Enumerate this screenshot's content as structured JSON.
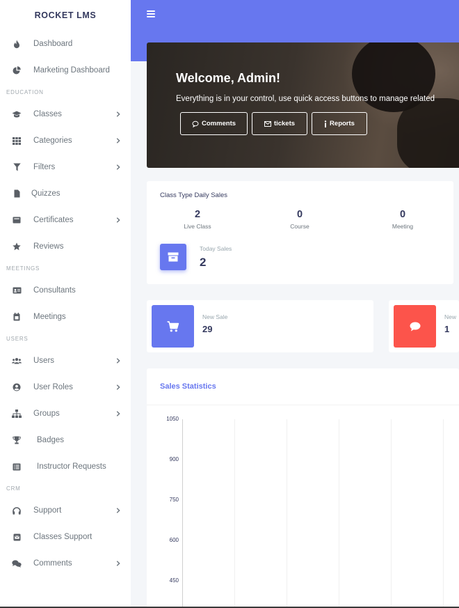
{
  "sidebar": {
    "brand": "ROCKET LMS",
    "items": [
      {
        "type": "item",
        "name": "sidebar-item-dashboard",
        "icon": "fire-icon",
        "label": "Dashboard",
        "chevron": false
      },
      {
        "type": "item",
        "name": "sidebar-item-marketing-dashboard",
        "icon": "chart-pie-icon",
        "label": "Marketing Dashboard",
        "chevron": false
      },
      {
        "type": "header",
        "label": "EDUCATION"
      },
      {
        "type": "item",
        "name": "sidebar-item-classes",
        "icon": "graduation-cap-icon",
        "label": "Classes",
        "chevron": true
      },
      {
        "type": "item",
        "name": "sidebar-item-categories",
        "icon": "th-icon",
        "label": "Categories",
        "chevron": true
      },
      {
        "type": "item",
        "name": "sidebar-item-filters",
        "icon": "filter-icon",
        "label": "Filters",
        "chevron": true
      },
      {
        "type": "item",
        "name": "sidebar-item-quizzes",
        "icon": "file-icon",
        "label": "Quizzes",
        "chevron": false,
        "variant": "narrow"
      },
      {
        "type": "item",
        "name": "sidebar-item-certificates",
        "icon": "certificate-icon",
        "label": "Certificates",
        "chevron": true
      },
      {
        "type": "item",
        "name": "sidebar-item-reviews",
        "icon": "star-icon",
        "label": "Reviews",
        "chevron": false
      },
      {
        "type": "header",
        "label": "MEETINGS"
      },
      {
        "type": "item",
        "name": "sidebar-item-consultants",
        "icon": "id-card-icon",
        "label": "Consultants",
        "chevron": false
      },
      {
        "type": "item",
        "name": "sidebar-item-meetings",
        "icon": "calendar-icon",
        "label": "Meetings",
        "chevron": false
      },
      {
        "type": "header",
        "label": "USERS"
      },
      {
        "type": "item",
        "name": "sidebar-item-users",
        "icon": "users-icon",
        "label": "Users",
        "chevron": true
      },
      {
        "type": "item",
        "name": "sidebar-item-user-roles",
        "icon": "user-circle-icon",
        "label": "User Roles",
        "chevron": true
      },
      {
        "type": "item",
        "name": "sidebar-item-groups",
        "icon": "sitemap-icon",
        "label": "Groups",
        "chevron": true
      },
      {
        "type": "item",
        "name": "sidebar-item-badges",
        "icon": "trophy-icon",
        "label": "Badges",
        "chevron": false,
        "variant": "wide"
      },
      {
        "type": "item",
        "name": "sidebar-item-instructor-requests",
        "icon": "list-alt-icon",
        "label": "Instructor Requests",
        "chevron": false,
        "variant": "wide"
      },
      {
        "type": "header",
        "label": "CRM"
      },
      {
        "type": "item",
        "name": "sidebar-item-support",
        "icon": "headphones-icon",
        "label": "Support",
        "chevron": true
      },
      {
        "type": "item",
        "name": "sidebar-item-classes-support",
        "icon": "envelope-square-icon",
        "label": "Classes Support",
        "chevron": false
      },
      {
        "type": "item",
        "name": "sidebar-item-comments",
        "icon": "comments-icon",
        "label": "Comments",
        "chevron": true
      }
    ]
  },
  "topbar": {
    "menu_icon": "hamburger-icon",
    "color": "#6777ef"
  },
  "hero": {
    "title": "Welcome, Admin!",
    "subtitle": "Everything is in your control, use quick access buttons to manage related",
    "buttons": [
      {
        "name": "comments-button",
        "icon": "comment-icon",
        "label": "Comments"
      },
      {
        "name": "tickets-button",
        "icon": "envelope-icon",
        "label": "tickets"
      },
      {
        "name": "reports-button",
        "icon": "info-icon",
        "label": "Reports"
      }
    ]
  },
  "class_type_sales": {
    "title": "Class Type Daily Sales",
    "stats": [
      {
        "value": "2",
        "label": "Live Class"
      },
      {
        "value": "0",
        "label": "Course"
      },
      {
        "value": "0",
        "label": "Meeting"
      }
    ],
    "today_label": "Today Sales",
    "today_value": "2"
  },
  "mini_cards": [
    {
      "name": "new-sale-card",
      "icon": "shopping-cart-icon",
      "color": "#6777ef",
      "label": "New Sale",
      "value": "29"
    },
    {
      "name": "new-comment-card",
      "icon": "comment-icon",
      "color": "#fc544b",
      "label": "New",
      "value": "1"
    }
  ],
  "sales_statistics": {
    "title": "Sales Statistics",
    "chart_data": {
      "type": "line",
      "title": "",
      "y_ticks": [
        "1050",
        "900",
        "750",
        "600",
        "450"
      ],
      "ylim_visible": [
        450,
        1050
      ],
      "grid": true,
      "series": []
    }
  }
}
